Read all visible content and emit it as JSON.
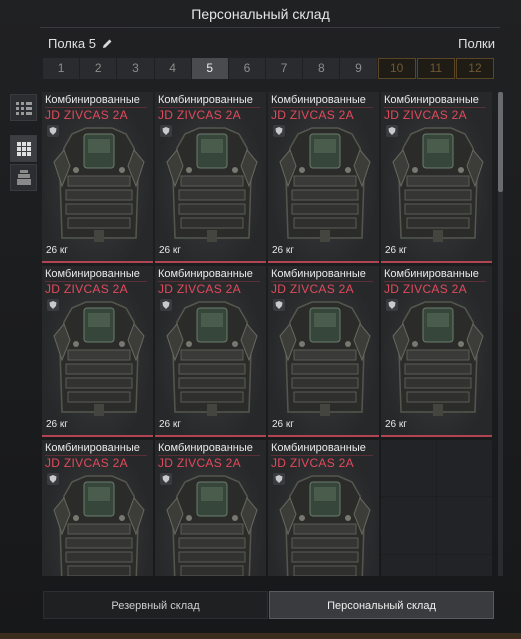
{
  "window": {
    "title": "Персональный склад"
  },
  "shelf": {
    "name": "Полка 5",
    "shelves_link": "Полки"
  },
  "tabs": [
    {
      "label": "1",
      "state": "normal"
    },
    {
      "label": "2",
      "state": "normal"
    },
    {
      "label": "3",
      "state": "normal"
    },
    {
      "label": "4",
      "state": "normal"
    },
    {
      "label": "5",
      "state": "active"
    },
    {
      "label": "6",
      "state": "normal"
    },
    {
      "label": "7",
      "state": "normal"
    },
    {
      "label": "8",
      "state": "normal"
    },
    {
      "label": "9",
      "state": "normal"
    },
    {
      "label": "10",
      "state": "locked"
    },
    {
      "label": "11",
      "state": "locked"
    },
    {
      "label": "12",
      "state": "locked"
    }
  ],
  "sidebar": {
    "buttons": [
      {
        "icon": "list-view-icon"
      },
      {
        "icon": "grid-view-icon",
        "active": true
      },
      {
        "icon": "stack-icon"
      }
    ]
  },
  "items": [
    {
      "category": "Комбинированные",
      "name": "JD ZIVCAS 2A",
      "weight": "26 кг"
    },
    {
      "category": "Комбинированные",
      "name": "JD ZIVCAS 2A",
      "weight": "26 кг"
    },
    {
      "category": "Комбинированные",
      "name": "JD ZIVCAS 2A",
      "weight": "26 кг"
    },
    {
      "category": "Комбинированные",
      "name": "JD ZIVCAS 2A",
      "weight": "26 кг"
    },
    {
      "category": "Комбинированные",
      "name": "JD ZIVCAS 2A",
      "weight": "26 кг"
    },
    {
      "category": "Комбинированные",
      "name": "JD ZIVCAS 2A",
      "weight": "26 кг"
    },
    {
      "category": "Комбинированные",
      "name": "JD ZIVCAS 2A",
      "weight": "26 кг"
    },
    {
      "category": "Комбинированные",
      "name": "JD ZIVCAS 2A",
      "weight": "26 кг"
    },
    {
      "category": "Комбинированные",
      "name": "JD ZIVCAS 2A",
      "weight": ""
    },
    {
      "category": "Комбинированные",
      "name": "JD ZIVCAS 2A",
      "weight": ""
    },
    {
      "category": "Комбинированные",
      "name": "JD ZIVCAS 2A",
      "weight": ""
    }
  ],
  "bottom_tabs": [
    {
      "label": "Резервный склад",
      "active": false
    },
    {
      "label": "Персональный склад",
      "active": true
    }
  ],
  "colors": {
    "accent_red": "#e24a5c",
    "locked_gold": "#6e5a33"
  }
}
